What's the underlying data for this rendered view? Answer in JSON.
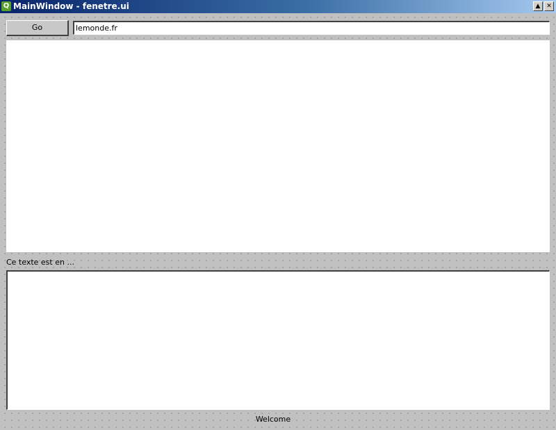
{
  "window": {
    "title": "MainWindow - fenetre.ui",
    "icon": "qt-designer-icon",
    "minimize_glyph": "▲",
    "close_glyph": "✕"
  },
  "toolbar": {
    "go_label": "Go",
    "url_value": "lemonde.fr"
  },
  "main": {
    "text_label": "Ce texte est en ...",
    "status_label": "Welcome"
  }
}
